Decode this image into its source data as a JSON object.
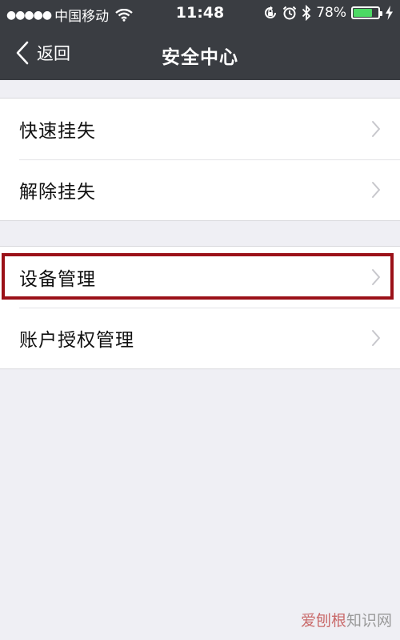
{
  "status_bar": {
    "signal_dots": "●●●●●",
    "carrier": "中国移动",
    "time": "11:48",
    "battery_percent": "78%",
    "battery_level": 0.78,
    "icons": [
      "wifi-icon",
      "lock-rotation-icon",
      "alarm-icon",
      "bluetooth-icon",
      "battery-icon",
      "charging-icon"
    ]
  },
  "nav": {
    "back_label": "返回",
    "title": "安全中心"
  },
  "groups": [
    {
      "items": [
        {
          "label": "快速挂失"
        },
        {
          "label": "解除挂失"
        }
      ]
    },
    {
      "items": [
        {
          "label": "设备管理"
        },
        {
          "label": "账户授权管理"
        }
      ]
    }
  ],
  "highlighted_item": "设备管理",
  "colors": {
    "nav_background": "#3a3d42",
    "page_background": "#efeff4",
    "highlight_border": "#9b1118",
    "battery_fill": "#4cd964"
  },
  "watermark": {
    "part1": "爱刨根",
    "part2": "知识网"
  }
}
